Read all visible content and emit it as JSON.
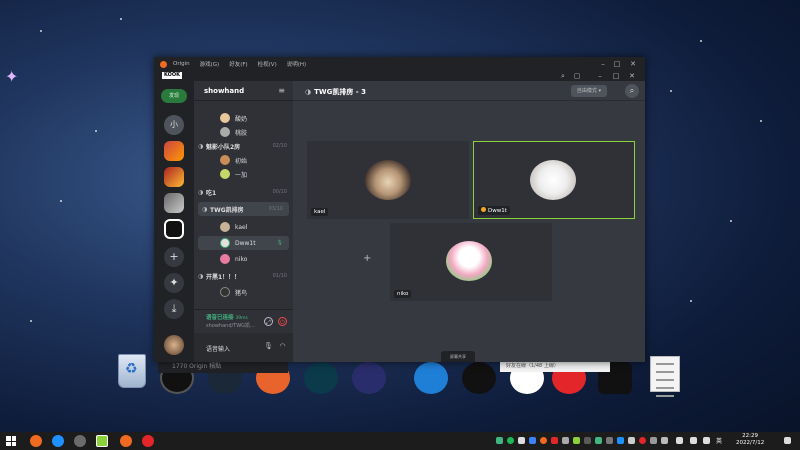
{
  "window": {
    "app_name": "Origin",
    "menu": [
      "Origin",
      "游戏(G)",
      "好友(F)",
      "检视(V)",
      "说明(H)"
    ],
    "kook_logo": "KOOK"
  },
  "rail": {
    "home_label": "发现",
    "second_server_label": "小"
  },
  "channel_panel": {
    "server_name": "showhand",
    "rows": [
      {
        "type": "user",
        "name": "酸奶"
      },
      {
        "type": "user",
        "name": "桃胶"
      },
      {
        "type": "channel",
        "name": "魅影小队2房",
        "count": "02/10"
      },
      {
        "type": "user",
        "name": "初始"
      },
      {
        "type": "user",
        "name": "一加"
      },
      {
        "type": "channel",
        "name": "吃1",
        "count": "00/10"
      },
      {
        "type": "channel",
        "name": "TWG凯排房",
        "count": "03/10"
      },
      {
        "type": "user",
        "name": "kael"
      },
      {
        "type": "user",
        "name": "Dww1t"
      },
      {
        "type": "user",
        "name": "niko"
      },
      {
        "type": "channel",
        "name": "开黑1！！！",
        "count": "01/10"
      },
      {
        "type": "user",
        "name": "猪鸟"
      }
    ],
    "voice_status": "语音已连接",
    "ping": "39ms",
    "voice_sub": "showhand/TWG凯...",
    "user_bar_label": "语音输入"
  },
  "main": {
    "title": "TWG凯排房 - 3",
    "mode_button": "自由模式 ▾",
    "tiles": [
      {
        "name": "kael",
        "active": false
      },
      {
        "name": "Dww1t",
        "active": true
      },
      {
        "name": "niko",
        "active": false
      }
    ],
    "share_tab": "屏幕共享"
  },
  "desktop": {
    "dock_label": "1770 Origin 積點",
    "dock_label2": "好友在線（1/48 上線）"
  },
  "taskbar": {
    "lang": "英",
    "time": "22:29",
    "date": "2022/7/12"
  },
  "colors": {
    "accent_green": "#8bd13a",
    "status_green": "#43b581",
    "origin_orange": "#f06a22"
  }
}
